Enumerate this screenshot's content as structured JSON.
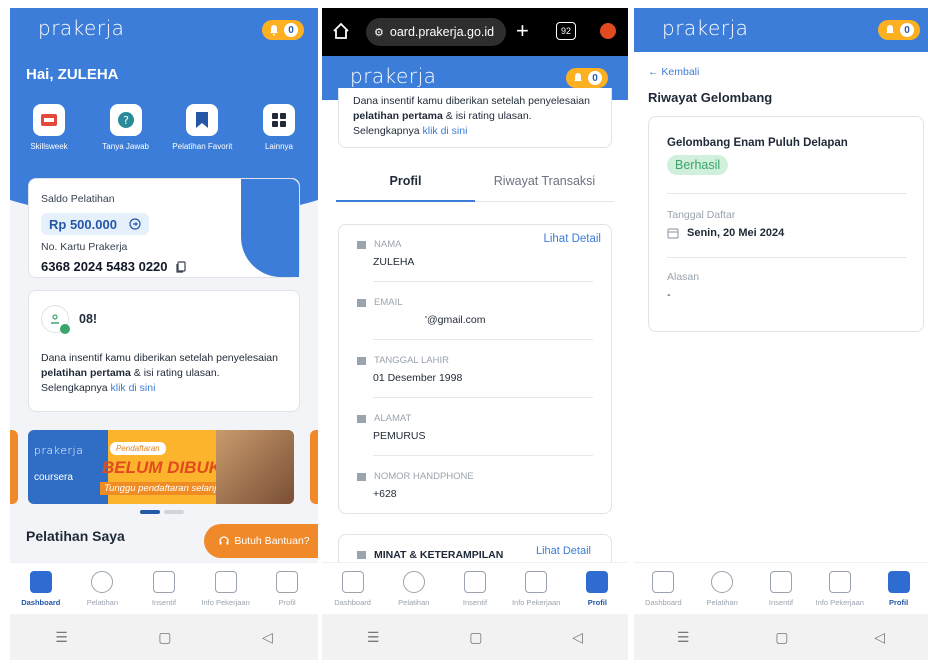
{
  "brand": {
    "logo": "prakerja",
    "notif_count": "0"
  },
  "screen1": {
    "greeting": "Hai, ZULEHA",
    "menu": [
      {
        "label": "Skillsweek",
        "icon": "skillsweek-icon"
      },
      {
        "label": "Tanya Jawab",
        "icon": "question-icon"
      },
      {
        "label": "Pelatihan Favorit",
        "icon": "bookmark-icon"
      },
      {
        "label": "Lainnya",
        "icon": "grid-icon"
      }
    ],
    "saldo_label": "Saldo Pelatihan",
    "saldo_value": "Rp 500.000",
    "kartu_label": "No. Kartu Prakerja",
    "kartu_number": "6368 2024 5483 0220",
    "insentif_id": "08!",
    "insentif_text_1": "Dana insentif kamu diberikan setelah penyelesaian",
    "insentif_bold": "pelatihan pertama",
    "insentif_text_2": "& isi rating ulasan.",
    "insentif_more": "Selengkapnya",
    "insentif_link": "klik di sini",
    "banner": {
      "brand": "prakerja",
      "partner": "coursera",
      "tag": "Pendaftaran",
      "title": "BELUM DIBUKA",
      "subtitle": "Tunggu pendaftaran selanjutnya"
    },
    "section_title": "Pelatihan Saya",
    "help_button": "Butuh Bantuan?"
  },
  "screen2": {
    "url": "oard.prakerja.go.id",
    "tab_count": "92",
    "top_text_1": "Dana insentif kamu diberikan setelah penyelesaian",
    "top_bold": "pelatihan pertama",
    "top_text_2": "& isi rating ulasan.",
    "top_more": "Selengkapnya",
    "top_link": "klik di sini",
    "tab_profil": "Profil",
    "tab_riwayat": "Riwayat Transaksi",
    "lihat_detail": "Lihat Detail",
    "fields": [
      {
        "label": "NAMA",
        "value": "ZULEHA"
      },
      {
        "label": "EMAIL",
        "value": "'@gmail.com"
      },
      {
        "label": "TANGGAL LAHIR",
        "value": "01 Desember 1998"
      },
      {
        "label": "ALAMAT",
        "value": "PEMURUS"
      },
      {
        "label": "NOMOR HANDPHONE",
        "value": "+628"
      }
    ],
    "minat_title": "MINAT & KETERAMPILAN",
    "minat_link": "Lihat Detail"
  },
  "screen3": {
    "back": "← Kembali",
    "title": "Riwayat Gelombang",
    "gelombang": "Gelombang Enam Puluh Delapan",
    "status": "Berhasil",
    "tanggal_label": "Tanggal Daftar",
    "tanggal_value": "Senin, 20 Mei 2024",
    "alasan_label": "Alasan",
    "alasan_value": "-"
  },
  "bottom_nav": [
    "Dashboard",
    "Pelatihan",
    "Insentif",
    "Info Pekerjaan",
    "Profil"
  ],
  "system_nav": [
    "☰",
    "▢",
    "◁"
  ],
  "colors": {
    "primary": "#3b7dd8",
    "accent": "#fdb022",
    "orange": "#f0892a",
    "success": "#3aa56a"
  }
}
